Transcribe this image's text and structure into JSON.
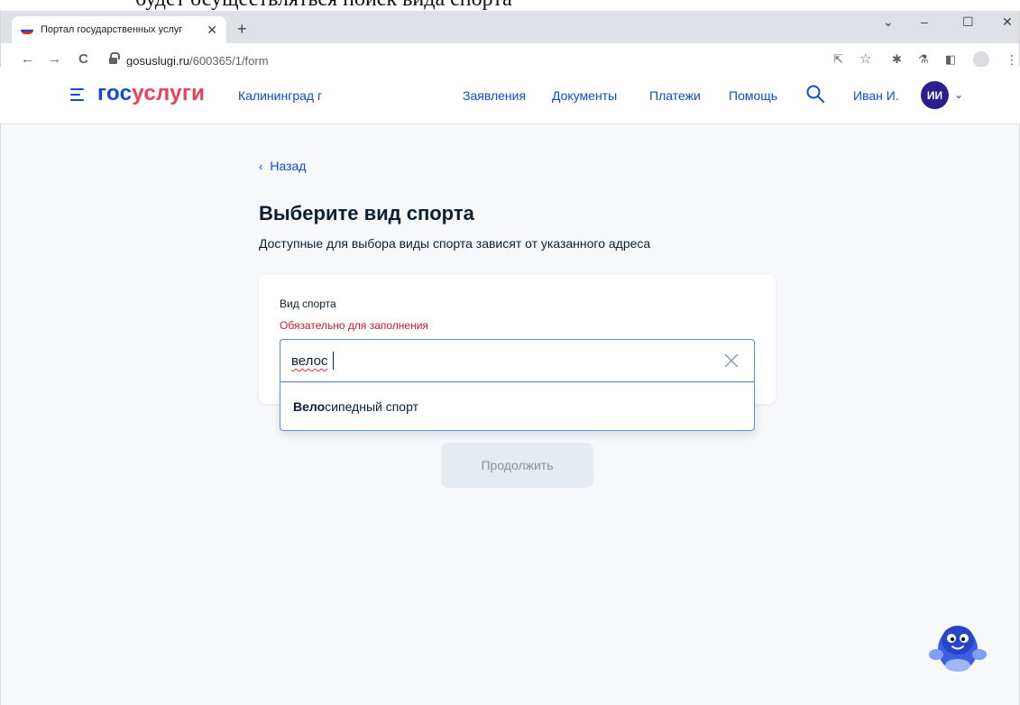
{
  "doc_strip_text": "будет осуществляться поиск вида спорта",
  "browser": {
    "tab_title": "Портал государственных услуг",
    "tab_close": "✕",
    "new_tab": "+",
    "url_host": "gosuslugi.ru",
    "url_path": "/600365/1/form",
    "win_dropdown": "⌄",
    "win_minimize": "–",
    "win_maximize": "☐",
    "win_close": "✕",
    "back": "←",
    "forward": "→",
    "reload": "C",
    "share": "⇱",
    "star": "☆",
    "extensions": "✱",
    "labs": "⚗",
    "sidepanel": "◧",
    "menu": "⋮"
  },
  "header": {
    "logo_part1": "гос",
    "logo_part2": "услуги",
    "city": "Калининград г",
    "nav": [
      "Заявления",
      "Документы",
      "Платежи",
      "Помощь"
    ],
    "user_name": "Иван И.",
    "avatar_initials": "ИИ",
    "chevron": "⌄"
  },
  "content": {
    "back_label": "Назад",
    "title": "Выберите вид спорта",
    "subtitle": "Доступные для выбора виды спорта зависят от указанного адреса",
    "field_label": "Вид спорта",
    "field_error": "Обязательно для заполнения",
    "input_value": "велос",
    "option_match": "Вело",
    "option_rest": "сипедный спорт",
    "continue_label": "Продолжить"
  },
  "colors": {
    "brand_blue": "#0d4cd3",
    "brand_red": "#ee3f58",
    "error": "#c81a2e",
    "page_bg": "#f6f8fb"
  }
}
